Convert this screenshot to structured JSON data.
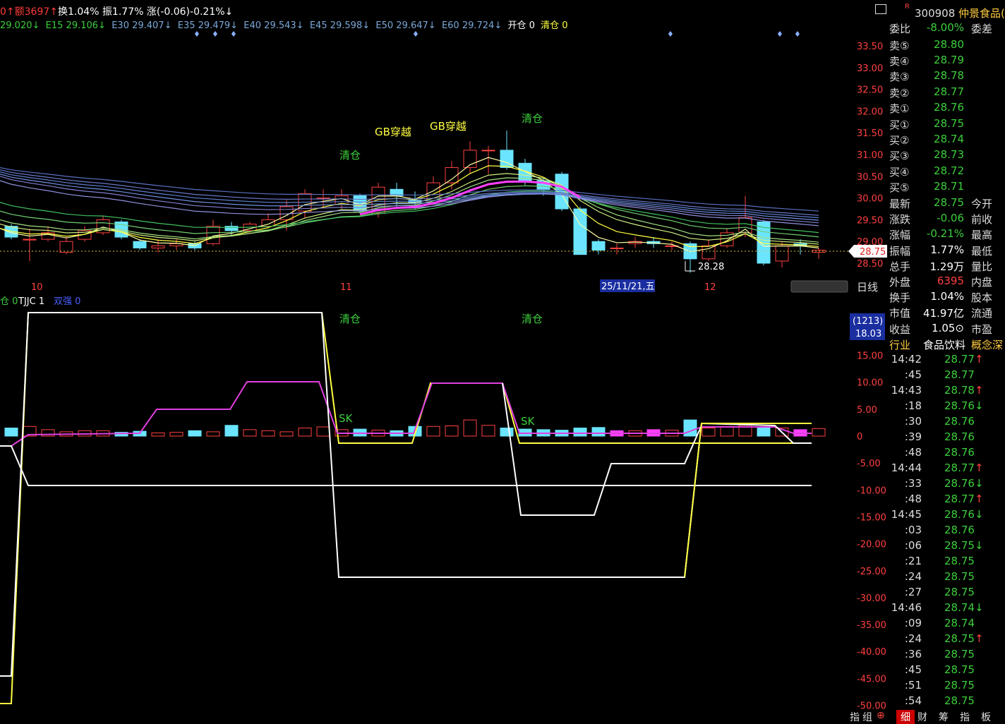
{
  "header": {
    "amount_label": "0↑额3697↑",
    "turnover": "换1.04%",
    "amplitude": "振1.77%",
    "change": "涨(-0.06)-0.21%↓"
  },
  "ema_line": {
    "e10": "29.020↓",
    "e15": "E15 29.106↓",
    "e30": "E30 29.407↓",
    "e35": "E35 29.479↓",
    "e40": "E40 29.543↓",
    "e45": "E45 29.598↓",
    "e50": "E50 29.647↓",
    "e60": "E60 29.724↓",
    "open_pos": "开仓 0",
    "clear_pos": "清仓 0"
  },
  "main_chart": {
    "y_ticks": [
      "33.50",
      "33.00",
      "32.50",
      "32.00",
      "31.50",
      "31.00",
      "30.50",
      "30.00",
      "29.50",
      "29.00",
      "28.50"
    ],
    "current_price_tag": "28.75",
    "low_marker": "28.28",
    "date_labels": [
      "10",
      "11",
      "12"
    ],
    "cursor_date": "25/11/21,五",
    "period": "日线",
    "signals": {
      "clear1": "清仓",
      "gb1": "GB穿越",
      "gb2": "GB穿越",
      "clear2": "清仓"
    }
  },
  "sub_chart": {
    "legend_a": "仓 0",
    "legend_b": "TJJC 1",
    "legend_c": "双强 0",
    "signals": {
      "clear1": "清仓",
      "clear2": "清仓",
      "sk1": "SK",
      "sk2": "SK"
    },
    "badge_top": "(1213)",
    "badge_bottom": "18.03",
    "y_ticks": [
      "15.00",
      "10.00",
      "5.00",
      "0",
      "-5.00",
      "-10.00",
      "-15.00",
      "-20.00",
      "-25.00",
      "-30.00",
      "-35.00",
      "-40.00",
      "-45.00",
      "-50.00"
    ]
  },
  "panel": {
    "code": "300908",
    "name": "仲景食品(",
    "r_mark": "R",
    "ratio": {
      "k": "委比",
      "v": "-8.00%",
      "k2": "委差"
    },
    "asks": [
      {
        "k": "卖⑤",
        "v": "28.80"
      },
      {
        "k": "卖④",
        "v": "28.79"
      },
      {
        "k": "卖③",
        "v": "28.78"
      },
      {
        "k": "卖②",
        "v": "28.77"
      },
      {
        "k": "卖①",
        "v": "28.76"
      }
    ],
    "bids": [
      {
        "k": "买①",
        "v": "28.75"
      },
      {
        "k": "买②",
        "v": "28.74"
      },
      {
        "k": "买③",
        "v": "28.73"
      },
      {
        "k": "买④",
        "v": "28.72"
      },
      {
        "k": "买⑤",
        "v": "28.71"
      }
    ],
    "stats": [
      {
        "k": "最新",
        "v": "28.75",
        "k2": "今开",
        "c": "green"
      },
      {
        "k": "涨跌",
        "v": "-0.06",
        "k2": "前收",
        "c": "green"
      },
      {
        "k": "涨幅",
        "v": "-0.21%",
        "k2": "最高",
        "c": "green"
      },
      {
        "k": "振幅",
        "v": "1.77%",
        "k2": "最低",
        "c": "white"
      },
      {
        "k": "总手",
        "v": "1.29万",
        "k2": "量比",
        "c": "white"
      },
      {
        "k": "外盘",
        "v": "6395",
        "k2": "内盘",
        "c": "red"
      },
      {
        "k": "换手",
        "v": "1.04%",
        "k2": "股本",
        "c": "white"
      },
      {
        "k": "市值",
        "v": "41.97亿",
        "k2": "流通",
        "c": "white"
      },
      {
        "k": "收益",
        "v": "1.05⊙",
        "k2": "市盈",
        "c": "white"
      }
    ],
    "industry": {
      "k": "行业",
      "v": "食品饮料",
      "k2": "概念深"
    },
    "ticks": [
      {
        "t": "14:42",
        "p": "28.77",
        "a": "↑"
      },
      {
        "t": ":45",
        "p": "28.77",
        "a": ""
      },
      {
        "t": "14:43",
        "p": "28.78",
        "a": "↑"
      },
      {
        "t": ":18",
        "p": "28.76",
        "a": "↓"
      },
      {
        "t": ":30",
        "p": "28.76",
        "a": ""
      },
      {
        "t": ":39",
        "p": "28.76",
        "a": ""
      },
      {
        "t": ":48",
        "p": "28.76",
        "a": ""
      },
      {
        "t": "14:44",
        "p": "28.77",
        "a": "↑"
      },
      {
        "t": ":33",
        "p": "28.76",
        "a": "↓"
      },
      {
        "t": ":48",
        "p": "28.77",
        "a": "↑"
      },
      {
        "t": "14:45",
        "p": "28.76",
        "a": "↓"
      },
      {
        "t": ":03",
        "p": "28.76",
        "a": ""
      },
      {
        "t": ":06",
        "p": "28.75",
        "a": "↓"
      },
      {
        "t": ":21",
        "p": "28.75",
        "a": ""
      },
      {
        "t": ":24",
        "p": "28.75",
        "a": ""
      },
      {
        "t": ":27",
        "p": "28.75",
        "a": ""
      },
      {
        "t": "14:46",
        "p": "28.74",
        "a": "↓"
      },
      {
        "t": ":09",
        "p": "28.74",
        "a": ""
      },
      {
        "t": ":24",
        "p": "28.75",
        "a": "↑"
      },
      {
        "t": ":36",
        "p": "28.75",
        "a": ""
      },
      {
        "t": ":45",
        "p": "28.75",
        "a": ""
      },
      {
        "t": ":51",
        "p": "28.75",
        "a": ""
      },
      {
        "t": ":54",
        "p": "28.75",
        "a": ""
      }
    ]
  },
  "bottom_tabs": [
    "指",
    "组",
    "细",
    "财",
    "筹",
    "指",
    "板"
  ],
  "candles": [
    {
      "o": 29.35,
      "c": 29.1,
      "h": 29.4,
      "l": 29.05
    },
    {
      "o": 29.05,
      "c": 29.05,
      "h": 29.3,
      "l": 28.55
    },
    {
      "o": 29.05,
      "c": 29.2,
      "h": 29.35,
      "l": 29.0
    },
    {
      "o": 28.75,
      "c": 29.0,
      "h": 29.1,
      "l": 28.7
    },
    {
      "o": 29.05,
      "c": 29.25,
      "h": 29.35,
      "l": 29.0
    },
    {
      "o": 29.2,
      "c": 29.5,
      "h": 29.6,
      "l": 29.15
    },
    {
      "o": 29.45,
      "c": 29.1,
      "h": 29.5,
      "l": 29.05
    },
    {
      "o": 29.0,
      "c": 28.85,
      "h": 29.05,
      "l": 28.8
    },
    {
      "o": 28.85,
      "c": 28.9,
      "h": 29.05,
      "l": 28.75
    },
    {
      "o": 28.9,
      "c": 28.95,
      "h": 29.05,
      "l": 28.8
    },
    {
      "o": 28.95,
      "c": 28.85,
      "h": 29.0,
      "l": 28.8
    },
    {
      "o": 28.95,
      "c": 29.35,
      "h": 29.5,
      "l": 28.9
    },
    {
      "o": 29.35,
      "c": 29.25,
      "h": 29.45,
      "l": 29.15
    },
    {
      "o": 29.25,
      "c": 29.4,
      "h": 29.45,
      "l": 29.2
    },
    {
      "o": 29.35,
      "c": 29.5,
      "h": 29.65,
      "l": 29.3
    },
    {
      "o": 29.5,
      "c": 29.8,
      "h": 29.95,
      "l": 29.25
    },
    {
      "o": 29.7,
      "c": 30.1,
      "h": 30.2,
      "l": 29.55
    },
    {
      "o": 30.0,
      "c": 30.0,
      "h": 30.2,
      "l": 29.8
    },
    {
      "o": 29.85,
      "c": 30.05,
      "h": 30.2,
      "l": 29.75
    },
    {
      "o": 30.05,
      "c": 29.7,
      "h": 30.1,
      "l": 29.65
    },
    {
      "o": 29.65,
      "c": 30.25,
      "h": 30.35,
      "l": 29.55
    },
    {
      "o": 30.2,
      "c": 30.05,
      "h": 30.35,
      "l": 29.8
    },
    {
      "o": 29.95,
      "c": 29.9,
      "h": 30.15,
      "l": 29.75
    },
    {
      "o": 29.9,
      "c": 30.35,
      "h": 30.5,
      "l": 29.85
    },
    {
      "o": 30.35,
      "c": 30.7,
      "h": 30.85,
      "l": 30.2
    },
    {
      "o": 30.7,
      "c": 31.1,
      "h": 31.3,
      "l": 30.55
    },
    {
      "o": 31.1,
      "c": 31.1,
      "h": 31.2,
      "l": 30.55
    },
    {
      "o": 31.1,
      "c": 30.7,
      "h": 31.55,
      "l": 30.65
    },
    {
      "o": 30.8,
      "c": 30.4,
      "h": 30.9,
      "l": 30.3
    },
    {
      "o": 30.4,
      "c": 30.2,
      "h": 30.45,
      "l": 30.05
    },
    {
      "o": 30.55,
      "c": 29.75,
      "h": 30.6,
      "l": 29.7
    },
    {
      "o": 29.75,
      "c": 28.7,
      "h": 29.8,
      "l": 28.7
    },
    {
      "o": 29.0,
      "c": 28.8,
      "h": 29.05,
      "l": 28.7
    },
    {
      "o": 28.85,
      "c": 28.85,
      "h": 28.95,
      "l": 28.7
    },
    {
      "o": 28.95,
      "c": 29.0,
      "h": 29.1,
      "l": 28.85
    },
    {
      "o": 29.0,
      "c": 28.95,
      "h": 29.1,
      "l": 28.85
    },
    {
      "o": 28.9,
      "c": 28.9,
      "h": 29.0,
      "l": 28.8
    },
    {
      "o": 28.95,
      "c": 28.6,
      "h": 29.0,
      "l": 28.28
    },
    {
      "o": 28.6,
      "c": 28.9,
      "h": 29.05,
      "l": 28.55
    },
    {
      "o": 28.9,
      "c": 29.2,
      "h": 29.3,
      "l": 28.85
    },
    {
      "o": 29.2,
      "c": 29.55,
      "h": 30.05,
      "l": 29.1
    },
    {
      "o": 29.45,
      "c": 28.5,
      "h": 29.5,
      "l": 28.45
    },
    {
      "o": 28.55,
      "c": 28.9,
      "h": 29.0,
      "l": 28.4
    },
    {
      "o": 28.95,
      "c": 28.9,
      "h": 29.05,
      "l": 28.7
    },
    {
      "o": 28.75,
      "c": 28.8,
      "h": 28.85,
      "l": 28.6
    }
  ]
}
